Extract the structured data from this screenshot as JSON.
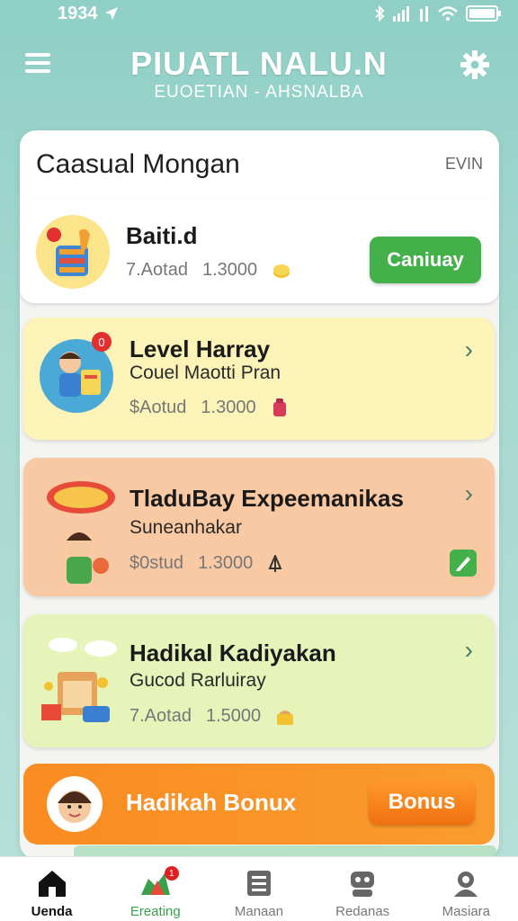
{
  "status_bar": {
    "time": "1934",
    "icons": [
      "location-arrow-icon",
      "bluetooth-icon",
      "signal-icon",
      "wifi-icon",
      "battery-icon"
    ]
  },
  "header": {
    "title": "PIUATL NALU.N",
    "subtitle": "EUOETIAN - AHSNALBA",
    "menu_icon": "hamburger-menu-icon",
    "settings_icon": "gear-icon"
  },
  "panel": {
    "title": "Caasual Mongan",
    "language": "EVIN"
  },
  "cards": [
    {
      "title": "Baiti.d",
      "subtitle": "",
      "meta_label": "7.Aotad",
      "meta_value": "1.3000",
      "button_label": "Caniuay",
      "bg": "#ffffff",
      "icon": "coin-stack-icon"
    },
    {
      "title": "Level Harray",
      "subtitle": "Couel Maotti Pran",
      "meta_label": "$Aotud",
      "meta_value": "1.3000",
      "badge": "0",
      "bg": "#fbf3b8",
      "icon": "gift-bag-icon"
    },
    {
      "title": "TladuBay Expeemanikas",
      "subtitle": "Suneanhakar",
      "meta_label": "$0stud",
      "meta_value": "1.3000",
      "bg": "#f9c9a3",
      "icon": "currency-icon"
    },
    {
      "title": "Hadikal Kadiyakan",
      "subtitle": "Gucod Rarluiray",
      "meta_label": "7.Aotad",
      "meta_value": "1.5000",
      "bg": "#e6f3b9",
      "icon": "treasure-icon"
    }
  ],
  "bonus": {
    "title": "Hadikah Bonux",
    "button_label": "Bonus"
  },
  "bottom_nav": [
    {
      "label": "Uenda",
      "icon": "home-icon"
    },
    {
      "label": "Ereating",
      "icon": "chart-icon",
      "badge": "1"
    },
    {
      "label": "Manaan",
      "icon": "list-icon"
    },
    {
      "label": "Redanas",
      "icon": "gamepad-icon"
    },
    {
      "label": "Masiara",
      "icon": "profile-icon"
    }
  ],
  "colors": {
    "accent_green": "#43b04a",
    "bonus_orange": "#f98c22",
    "header_teal": "#8fcfc6"
  }
}
